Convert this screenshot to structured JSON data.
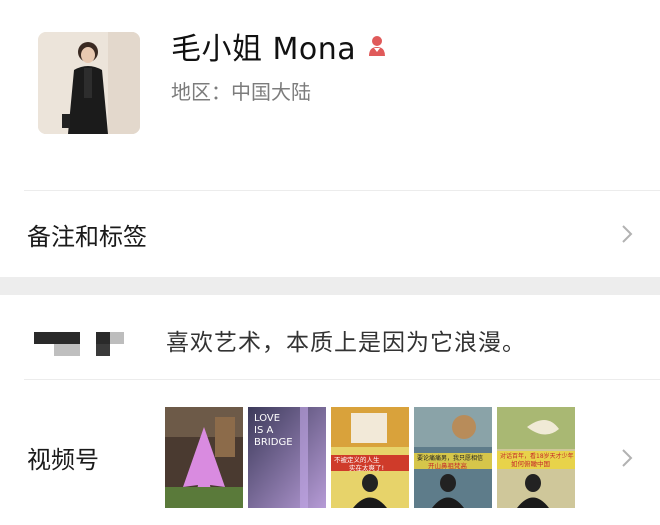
{
  "profile": {
    "name": "毛小姐 Mona",
    "region": "地区：中国大陆"
  },
  "rows": {
    "remark_label": "备注和标签",
    "channels_label": "视频号"
  },
  "moments": {
    "text": "喜欢艺术，本质上是因为它浪漫。"
  },
  "thumbs": [
    {
      "lines": []
    },
    {
      "lines": [
        "LOVE",
        "IS A",
        "BRIDGE"
      ]
    },
    {
      "lines": [
        "不被定义的人生",
        "实在太爽了!"
      ]
    },
    {
      "lines": [
        "要论痛痛男，我只愿相信",
        "开山鼻祖梵高"
      ]
    },
    {
      "lines": [
        "对话百年，看18岁天才少年",
        "如何俯瞰中国"
      ]
    }
  ],
  "colors": {
    "gender_icon": "#e05a5a",
    "chevron": "#b2b2b2",
    "section_gap": "#ededed"
  }
}
